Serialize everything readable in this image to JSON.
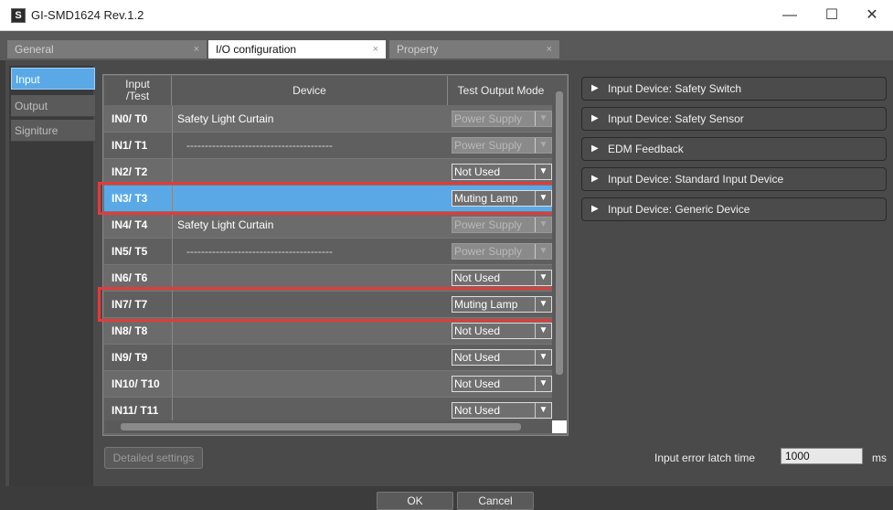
{
  "window": {
    "title": "GI-SMD1624 Rev.1.2",
    "minimize": "—",
    "maximize": "☐",
    "close": "✕"
  },
  "tabs": [
    {
      "label": "General",
      "close": "×"
    },
    {
      "label": "I/O configuration",
      "close": "×"
    },
    {
      "label": "Property",
      "close": "×"
    }
  ],
  "sidebar": {
    "items": [
      {
        "label": "Input"
      },
      {
        "label": "Output"
      },
      {
        "label": "Signiture"
      }
    ]
  },
  "table": {
    "headers": {
      "id": "Input\n/Test",
      "device": "Device",
      "mode": "Test Output Mode"
    },
    "rows": [
      {
        "id": "IN0/ T0",
        "device": "Safety Light Curtain",
        "mode": "Power Supply"
      },
      {
        "id": "IN1/ T1",
        "device": "----------------------------------------",
        "mode": "Power Supply"
      },
      {
        "id": "IN2/ T2",
        "device": "",
        "mode": "Not Used"
      },
      {
        "id": "IN3/ T3",
        "device": "",
        "mode": "Muting Lamp"
      },
      {
        "id": "IN4/ T4",
        "device": "Safety Light Curtain",
        "mode": "Power Supply"
      },
      {
        "id": "IN5/ T5",
        "device": "----------------------------------------",
        "mode": "Power Supply"
      },
      {
        "id": "IN6/ T6",
        "device": "",
        "mode": "Not Used"
      },
      {
        "id": "IN7/ T7",
        "device": "",
        "mode": "Muting Lamp"
      },
      {
        "id": "IN8/ T8",
        "device": "",
        "mode": "Not Used"
      },
      {
        "id": "IN9/ T9",
        "device": "",
        "mode": "Not Used"
      },
      {
        "id": "IN10/ T10",
        "device": "",
        "mode": "Not Used"
      },
      {
        "id": "IN11/ T11",
        "device": "",
        "mode": "Not Used"
      }
    ],
    "dropdown_arrow": "▼"
  },
  "device_buttons": [
    {
      "label": "Input Device: Safety Switch"
    },
    {
      "label": "Input Device: Safety Sensor"
    },
    {
      "label": "EDM Feedback"
    },
    {
      "label": "Input Device: Standard Input Device"
    },
    {
      "label": "Input Device: Generic Device"
    }
  ],
  "expand_glyph": "▶",
  "footer": {
    "detailed_settings": "Detailed settings",
    "latch_label": "Input error latch time",
    "latch_value": "1000",
    "latch_unit": "ms",
    "ok": "OK",
    "cancel": "Cancel"
  },
  "colors": {
    "selected_row": "#5aa9e6",
    "highlight_border": "#e23b3b"
  }
}
